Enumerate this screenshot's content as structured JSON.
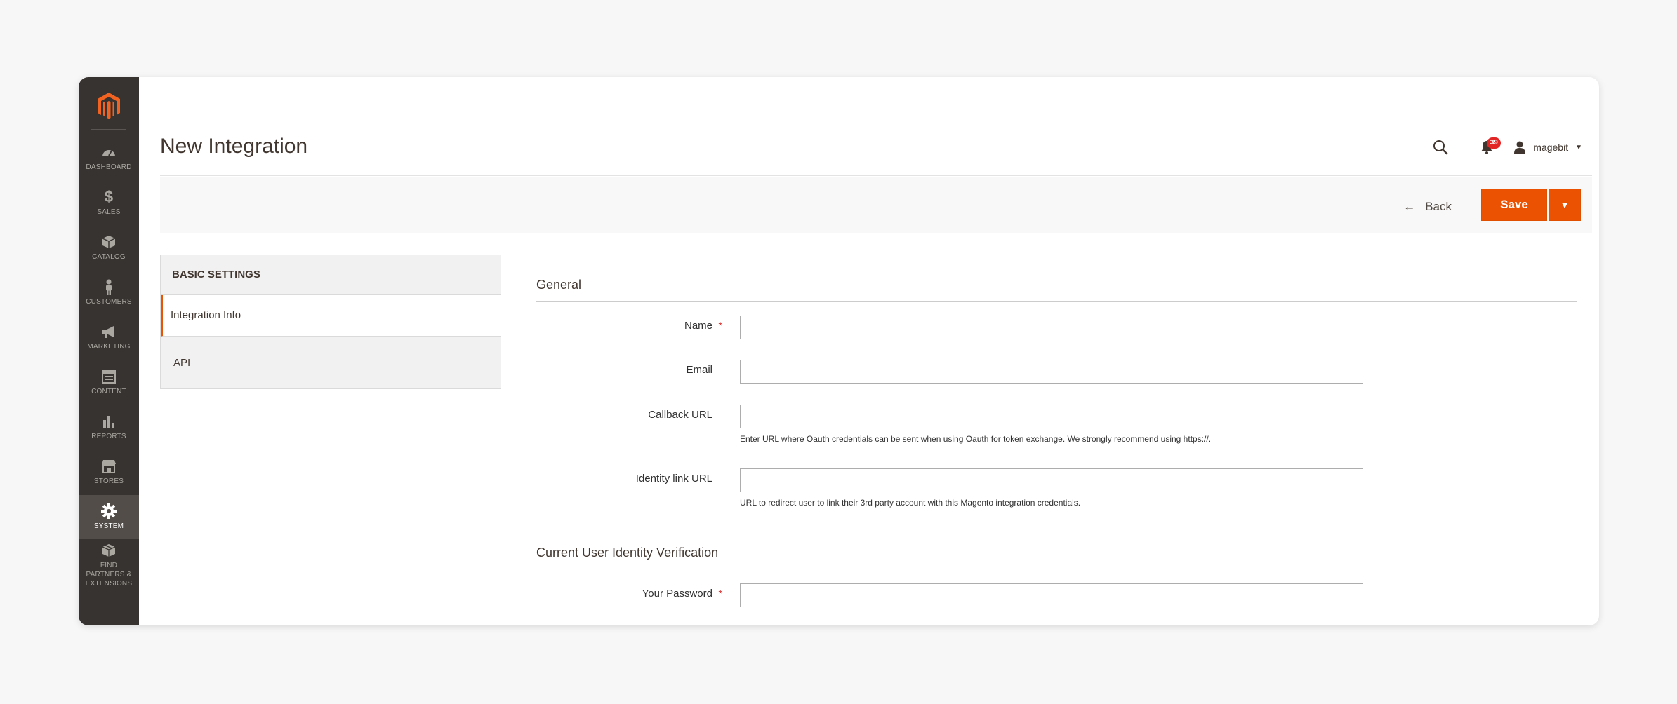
{
  "sidebar": {
    "logo": "magento-logo",
    "items": [
      {
        "label": "DASHBOARD",
        "icon": "dashboard-icon"
      },
      {
        "label": "SALES",
        "icon": "dollar-icon"
      },
      {
        "label": "CATALOG",
        "icon": "box-icon"
      },
      {
        "label": "CUSTOMERS",
        "icon": "person-icon"
      },
      {
        "label": "MARKETING",
        "icon": "megaphone-icon"
      },
      {
        "label": "CONTENT",
        "icon": "layout-icon"
      },
      {
        "label": "REPORTS",
        "icon": "bar-chart-icon"
      },
      {
        "label": "STORES",
        "icon": "store-icon"
      },
      {
        "label": "SYSTEM",
        "icon": "gear-icon",
        "active": true
      },
      {
        "label": "FIND PARTNERS & EXTENSIONS",
        "icon": "extensions-icon"
      }
    ]
  },
  "header": {
    "title": "New Integration",
    "notification_count": "39",
    "username": "magebit"
  },
  "actions": {
    "back_label": "Back",
    "save_label": "Save"
  },
  "tabs": {
    "heading": "BASIC SETTINGS",
    "items": [
      {
        "label": "Integration Info",
        "active": true
      },
      {
        "label": "API",
        "active": false
      }
    ]
  },
  "form": {
    "general_title": "General",
    "fields": [
      {
        "label": "Name",
        "required": true,
        "value": "",
        "note": ""
      },
      {
        "label": "Email",
        "required": false,
        "value": "",
        "note": ""
      },
      {
        "label": "Callback URL",
        "required": false,
        "value": "",
        "note": "Enter URL where Oauth credentials can be sent when using Oauth for token exchange. We strongly recommend using https://."
      },
      {
        "label": "Identity link URL",
        "required": false,
        "value": "",
        "note": "URL to redirect user to link their 3rd party account with this Magento integration credentials."
      }
    ],
    "verification_title": "Current User Identity Verification",
    "password": {
      "label": "Your Password",
      "required": true,
      "value": ""
    }
  },
  "colors": {
    "accent": "#eb5202",
    "sidebar_bg": "#373330",
    "sidebar_active": "#524d49",
    "required": "#e22626"
  }
}
